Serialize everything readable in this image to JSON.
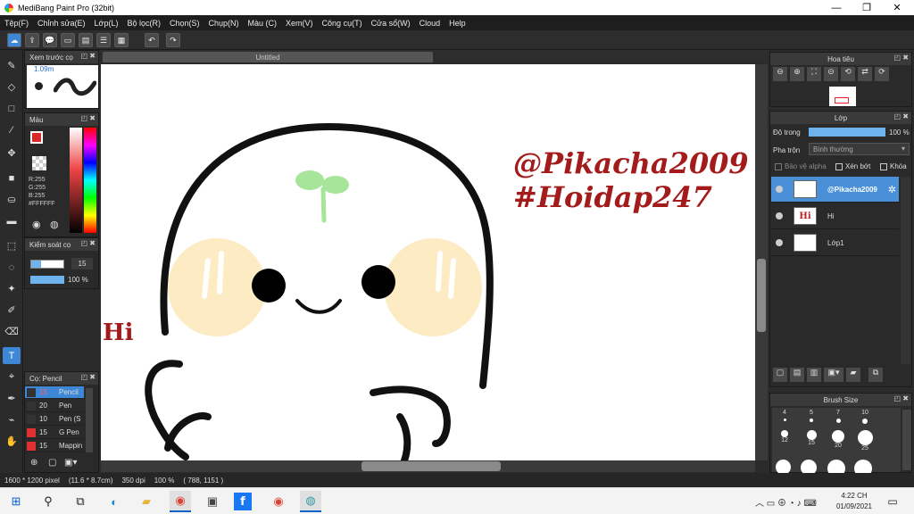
{
  "window": {
    "title": "MediBang Paint Pro (32bit)",
    "minimize": "—",
    "maximize": "❐",
    "close": "✕"
  },
  "menu": [
    "Tệp(F)",
    "Chỉnh sửa(E)",
    "Lớp(L)",
    "Bộ lọc(R)",
    "Chọn(S)",
    "Chụp(N)",
    "Màu (C)",
    "Xem(V)",
    "Công cụ(T)",
    "Cửa sổ(W)",
    "Cloud",
    "Help"
  ],
  "canvas": {
    "tab_title": "Untitled",
    "text_pikacha": "@Pikacha2009",
    "text_hoidap": "#Hoidap247",
    "text_hi": "Hi"
  },
  "brush_preview": {
    "title": "Xem trước cọ",
    "size": "1.09m"
  },
  "color_panel": {
    "title": "Màu",
    "r": "R:255",
    "g": "G:255",
    "b": "B:255",
    "hex": "#FFFFFF"
  },
  "brush_control": {
    "title": "Kiểm soát cọ",
    "size": "15",
    "opacity": "100 %"
  },
  "brush_list": {
    "title": "Cọ: Pencil",
    "items": [
      {
        "size": "15",
        "name": "Pencil",
        "color": "#333333"
      },
      {
        "size": "20",
        "name": "Pen",
        "color": "#333333"
      },
      {
        "size": "10",
        "name": "Pen (S",
        "color": "#333333"
      },
      {
        "size": "15",
        "name": "G Pen",
        "color": "#e03030"
      },
      {
        "size": "15",
        "name": "Mapping",
        "color": "#e03030"
      }
    ]
  },
  "navigator": {
    "title": "Hoa tiêu"
  },
  "layers": {
    "title": "Lớp",
    "opacity_label": "Độ trong",
    "opacity_value": "100 %",
    "blend_label": "Pha trộn",
    "blend_value": "Bình thường",
    "protect_alpha": "Bảo vệ alpha",
    "clipping": "Xén bớt",
    "lock": "Khóa",
    "items": [
      {
        "name": "@Pikacha2009",
        "thumb": ""
      },
      {
        "name": "Hi",
        "thumb": "Hi"
      },
      {
        "name": "Lớp1",
        "thumb": ""
      }
    ]
  },
  "brush_size": {
    "title": "Brush Size",
    "sizes": [
      "4",
      "5",
      "7",
      "10",
      "12",
      "15",
      "20",
      "25"
    ]
  },
  "status": {
    "dimensions": "1600 * 1200 pixel",
    "physical": "(11.6 * 8.7cm)",
    "dpi": "350 dpi",
    "zoom": "100 %",
    "coords": "( 788, 1151 )"
  },
  "taskbar": {
    "time": "4:22 CH",
    "date": "01/09/2021"
  },
  "colors": {
    "accent": "#3d87d6",
    "brand_red": "#a31b1b",
    "sprout": "#a6e59a",
    "cheek": "#fdebc4"
  }
}
